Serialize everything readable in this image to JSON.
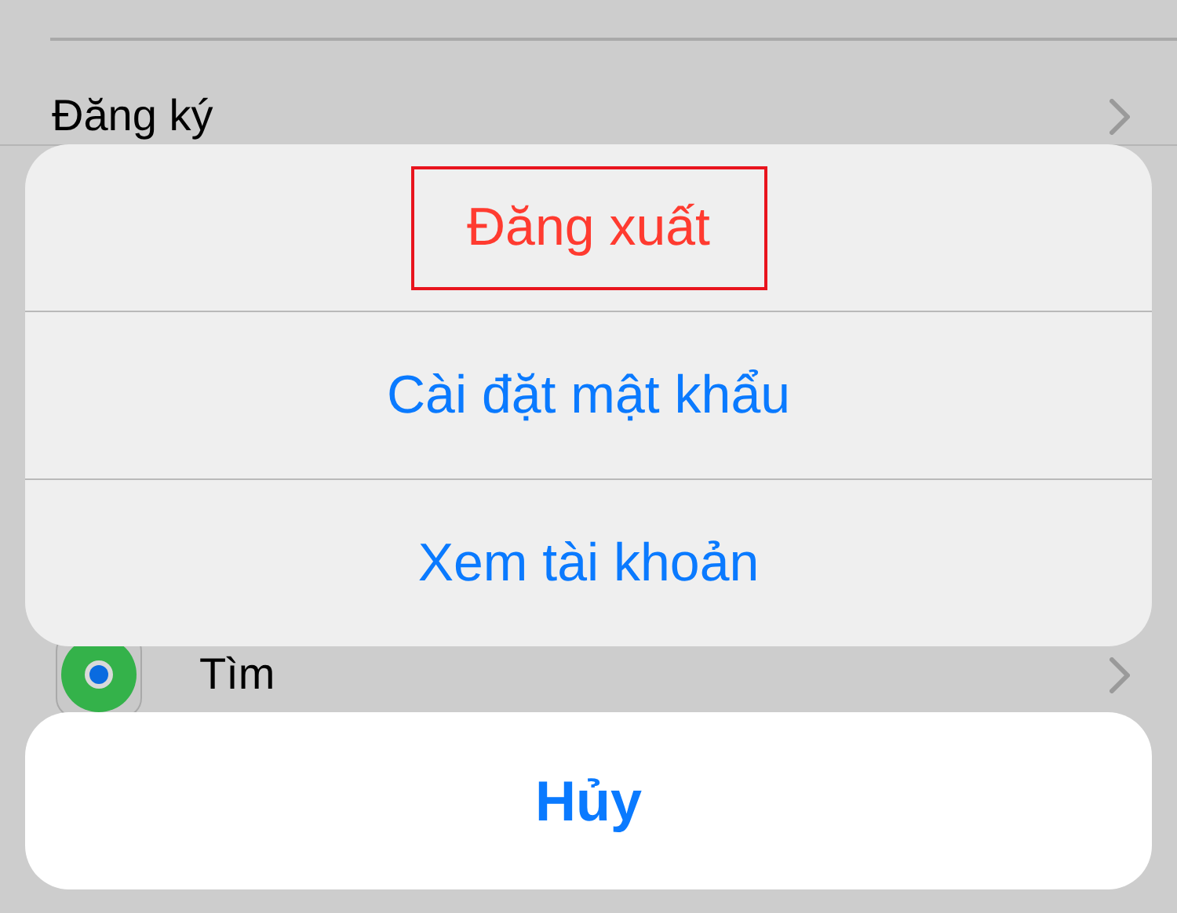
{
  "background_list": {
    "rows": [
      {
        "label": "Đăng ký",
        "kind": "plain"
      },
      {
        "label": "Tìm",
        "kind": "find"
      }
    ]
  },
  "action_sheet": {
    "actions": [
      {
        "label": "Đăng xuất",
        "kind": "destructive",
        "highlighted": true
      },
      {
        "label": "Cài đặt mật khẩu",
        "kind": "default",
        "highlighted": false
      },
      {
        "label": "Xem tài khoản",
        "kind": "default",
        "highlighted": false
      }
    ],
    "cancel": {
      "label": "Hủy"
    }
  }
}
